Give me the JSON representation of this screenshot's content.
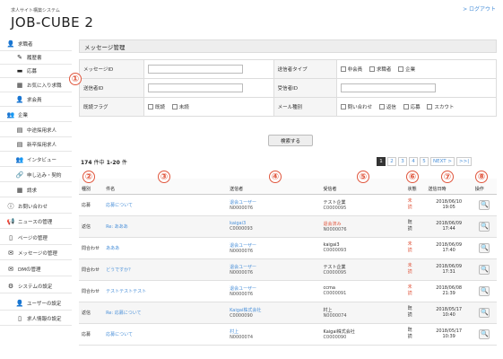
{
  "header": {
    "site_label": "求人サイト構築システム",
    "app_title": "JOB-CUBE 2",
    "logout": "> ログアウト"
  },
  "sidebar": {
    "items": [
      {
        "label": "求職者",
        "icon": "user-icon"
      },
      {
        "label": "履歴書",
        "icon": "pencil-icon"
      },
      {
        "label": "応募",
        "icon": "briefcase-icon"
      },
      {
        "label": "お気に入り求職",
        "icon": "gift-icon"
      },
      {
        "label": "求会員",
        "icon": "user-icon"
      },
      {
        "label": "企業",
        "icon": "users-icon"
      },
      {
        "label": "中途採用求人",
        "icon": "copy-icon"
      },
      {
        "label": "新卒採用求人",
        "icon": "copy-icon"
      },
      {
        "label": "インタビュー",
        "icon": "users-icon"
      },
      {
        "label": "申し込み・契約",
        "icon": "link-icon"
      },
      {
        "label": "請求",
        "icon": "calculator-icon"
      },
      {
        "label": "お問い合わせ",
        "icon": "info-icon"
      },
      {
        "label": "ニュースの管理",
        "icon": "megaphone-icon"
      },
      {
        "label": "ページの管理",
        "icon": "page-icon"
      },
      {
        "label": "メッセージの管理",
        "icon": "envelope-icon"
      },
      {
        "label": "DMの管理",
        "icon": "envelope-icon"
      },
      {
        "label": "システムの設定",
        "icon": "network-icon"
      },
      {
        "label": "ユーザーの設定",
        "icon": "user-icon"
      },
      {
        "label": "求人情報の設定",
        "icon": "page-icon"
      }
    ]
  },
  "section_title": "メッセージ管理",
  "form": {
    "message_id": "メッセージID",
    "sender_type": "送信者タイプ",
    "sender_type_opts": [
      "非会員",
      "求職者",
      "企業"
    ],
    "sender_id": "送信者ID",
    "receiver_id": "受信者ID",
    "read_flag": "既読フラグ",
    "read_opts": [
      "既読",
      "未読"
    ],
    "mail_type": "メール種別",
    "mail_type_opts": [
      "問い合わせ",
      "返信",
      "応募",
      "スカウト"
    ],
    "search_btn": "検索する"
  },
  "results": {
    "count": "174",
    "count_unit": "件中",
    "range": "1-20",
    "range_unit": "件"
  },
  "pager": [
    "1",
    "2",
    "3",
    "4",
    "5",
    "NEXT >",
    ">>|"
  ],
  "markers": [
    "①",
    "②",
    "③",
    "④",
    "⑤",
    "⑥",
    "⑦",
    "⑧"
  ],
  "table": {
    "headers": [
      "種別",
      "件名",
      "送信者",
      "受信者",
      "状態",
      "送信日時",
      "操作"
    ],
    "rows": [
      {
        "type": "応募",
        "subject": "応募について",
        "sender": "退会ユーザー",
        "sender_id": "N0000076",
        "receiver": "テスト企業",
        "receiver_id": "C0000095",
        "status": "未読",
        "date": "2018/06/10",
        "time": "19:05"
      },
      {
        "type": "返信",
        "subject": "Re: あああ",
        "sender": "kaigai3",
        "sender_id": "C0000093",
        "receiver": "退会済み",
        "receiver_id": "N0000076",
        "status": "既読",
        "date": "2018/06/09",
        "time": "17:44"
      },
      {
        "type": "問合わせ",
        "subject": "あああ",
        "sender": "退会ユーザー",
        "sender_id": "N0000076",
        "receiver": "kaigai3",
        "receiver_id": "C0000093",
        "status": "未読",
        "date": "2018/06/09",
        "time": "17:40"
      },
      {
        "type": "問合わせ",
        "subject": "どうですか？",
        "sender": "退会ユーザー",
        "sender_id": "N0000076",
        "receiver": "テスト企業",
        "receiver_id": "C0000095",
        "status": "未読",
        "date": "2018/06/09",
        "time": "17:31"
      },
      {
        "type": "問合わせ",
        "subject": "テストテストテスト",
        "sender": "退会ユーザー",
        "sender_id": "N0000076",
        "receiver": "ccma",
        "receiver_id": "C0000091",
        "status": "未読",
        "date": "2018/06/08",
        "time": "21:39"
      },
      {
        "type": "返信",
        "subject": "Re: 応募について",
        "sender": "Kaigai株式会社",
        "sender_id": "C0000090",
        "receiver": "村上",
        "receiver_id": "N0000074",
        "status": "既読",
        "date": "2018/05/17",
        "time": "10:40"
      },
      {
        "type": "応募",
        "subject": "応募について",
        "sender": "村上",
        "sender_id": "N0000074",
        "receiver": "Kaigai株式会社",
        "receiver_id": "C0000090",
        "status": "既読",
        "date": "2018/05/17",
        "time": "10:39"
      }
    ]
  },
  "colors": {
    "accent": "#4a90d9",
    "marker": "#e0563d",
    "unread": "#e0563d"
  }
}
